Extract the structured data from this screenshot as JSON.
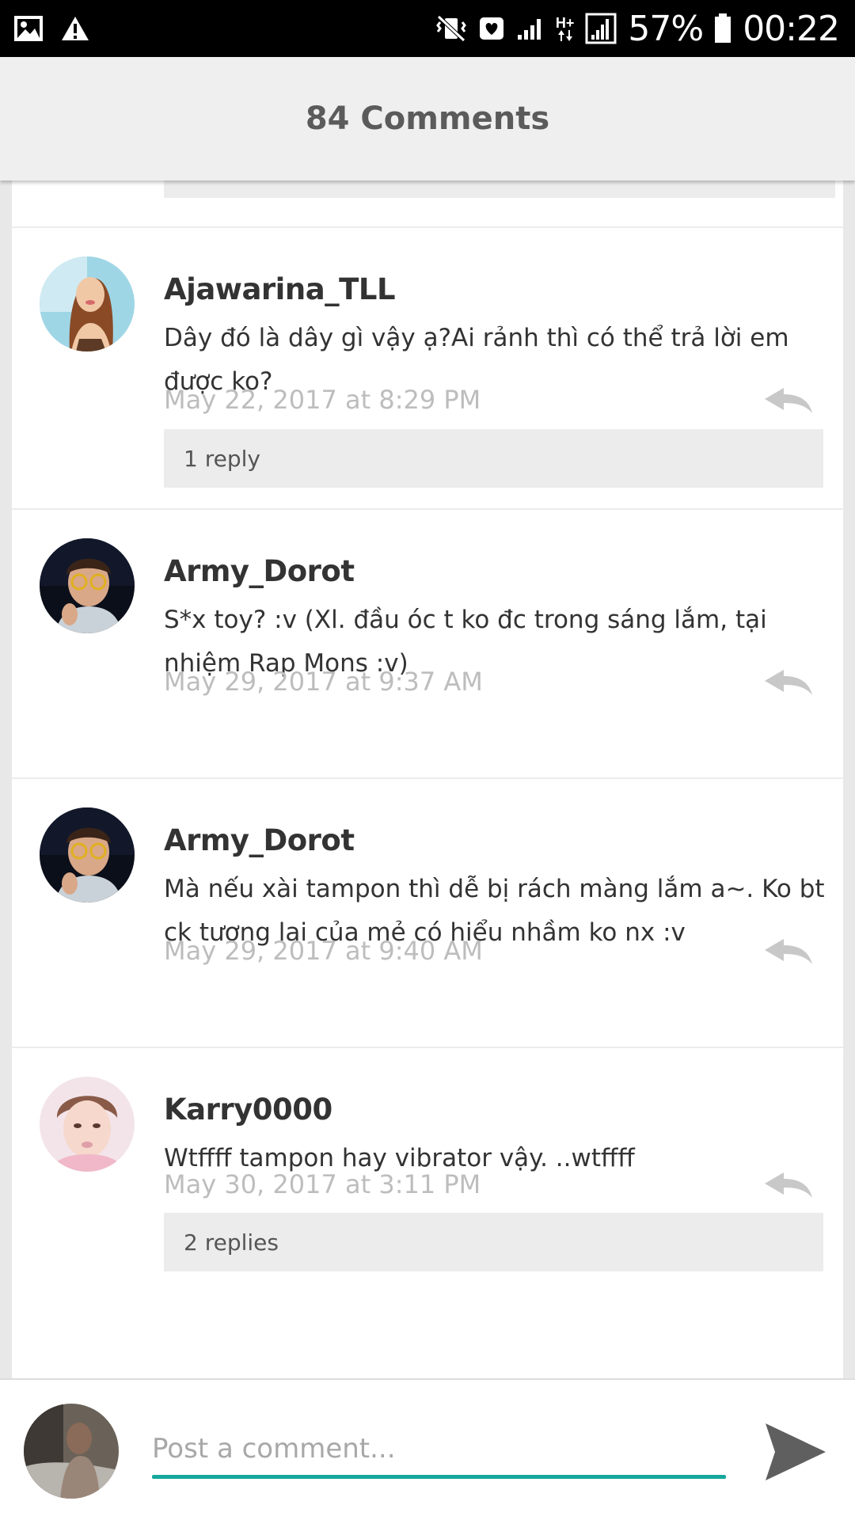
{
  "status_bar": {
    "battery_percent": "57%",
    "time": "00:22",
    "network_type": "H+",
    "left_icons": [
      "image-icon",
      "warning-icon"
    ],
    "right_icons": [
      "mute-vibrate-icon",
      "heart-notification-icon",
      "signal-icon",
      "data-icon",
      "signal-box-icon",
      "battery-icon"
    ]
  },
  "header": {
    "title": "84 Comments"
  },
  "comments": [
    {
      "author": "Ajawarina_TLL",
      "text": "Dây đó là dây gì vậy ạ?Ai rảnh thì có thể trả lời em được ko?",
      "date": "May 22, 2017 at 8:29 PM",
      "replies_label": "1 reply"
    },
    {
      "author": "Army_Dorot",
      "text": "S*x toy? :v (Xl. đầu óc t ko đc trong sáng lắm, tại nhiệm Rap Mons :v)",
      "date": "May 29, 2017 at 9:37 AM"
    },
    {
      "author": "Army_Dorot",
      "text": "Mà nếu xài tampon thì dễ bị rách màng lắm a~. Ko bt ck tương lai của mẻ có hiểu nhầm ko nx :v",
      "date": "May 29, 2017 at 9:40 AM"
    },
    {
      "author": "Karry0000",
      "text": "Wtffff tampon hay vibrator vậy.  ..wtffff",
      "date": "May 30, 2017 at 3:11 PM",
      "replies_label": "2 replies"
    }
  ],
  "composer": {
    "placeholder": "Post a comment...",
    "accent_color": "#16a89c"
  },
  "colors": {
    "header_bg": "#efefef",
    "header_text": "#5b5b5b",
    "date_text": "#bdbdbd",
    "replies_bg": "#ececec"
  }
}
